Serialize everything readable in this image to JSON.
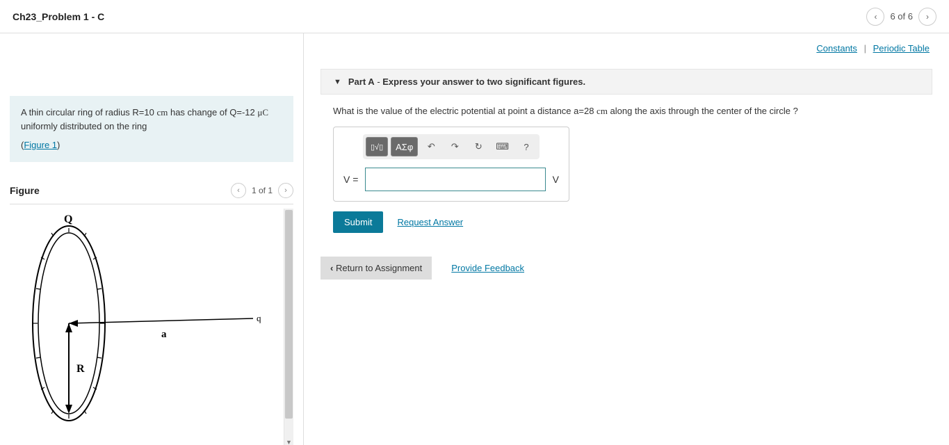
{
  "header": {
    "title": "Ch23_Problem 1  - C",
    "page_indicator": "6 of 6"
  },
  "links": {
    "constants": "Constants",
    "periodic": "Periodic Table"
  },
  "problem": {
    "text_prefix": "A thin circular ring of radius R=10 ",
    "unit_cm": "cm",
    "text_mid": " has change of Q=-12 ",
    "unit_uc": "μC",
    "text_suffix": " uniformly distributed on the ring",
    "figure_link": "Figure 1"
  },
  "figure": {
    "label": "Figure",
    "page": "1 of 1",
    "labels": {
      "Q": "Q",
      "R": "R",
      "a": "a",
      "q": "q"
    }
  },
  "partA": {
    "label": "Part A",
    "instruction": "Express your answer to two significant figures.",
    "question_prefix": "What is the value of the electric potential at point a distance a=28 ",
    "question_unit": "cm",
    "question_suffix": " along the axis through the center of the circle ?",
    "lhs": "V =",
    "unit": "V",
    "value": ""
  },
  "toolbar": {
    "templates": "▢√▢",
    "greek": "ΑΣφ",
    "undo": "↶",
    "redo": "↷",
    "reset": "↻",
    "keyboard": "⌨",
    "help": "?"
  },
  "actions": {
    "submit": "Submit",
    "request": "Request Answer",
    "return": "Return to Assignment",
    "feedback": "Provide Feedback"
  }
}
